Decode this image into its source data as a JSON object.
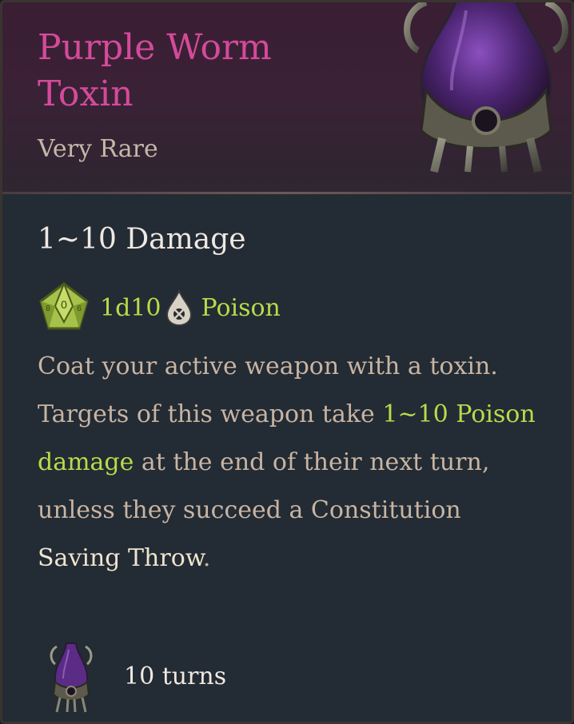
{
  "item": {
    "name": "Purple Worm Toxin",
    "rarity": "Very Rare",
    "rarity_color": "#c7b7a9",
    "name_color": "#d44a9a"
  },
  "damage": {
    "heading": "1~10 Damage",
    "dice": "1d10",
    "type": "Poison",
    "dice_icon": "d10-die-icon",
    "type_icon": "poison-drop-icon",
    "accent_color": "#b5dc4a"
  },
  "description": {
    "part1": "Coat your active weapon with a toxin. Targets of this weapon take ",
    "highlight1": "1~10 Poison damage",
    "part2": " at the end of their next turn, unless they succeed a Constitution ",
    "highlight2": "Saving Throw",
    "part3": "."
  },
  "duration": {
    "icon": "toxin-bottle-icon",
    "text": "10 turns"
  }
}
